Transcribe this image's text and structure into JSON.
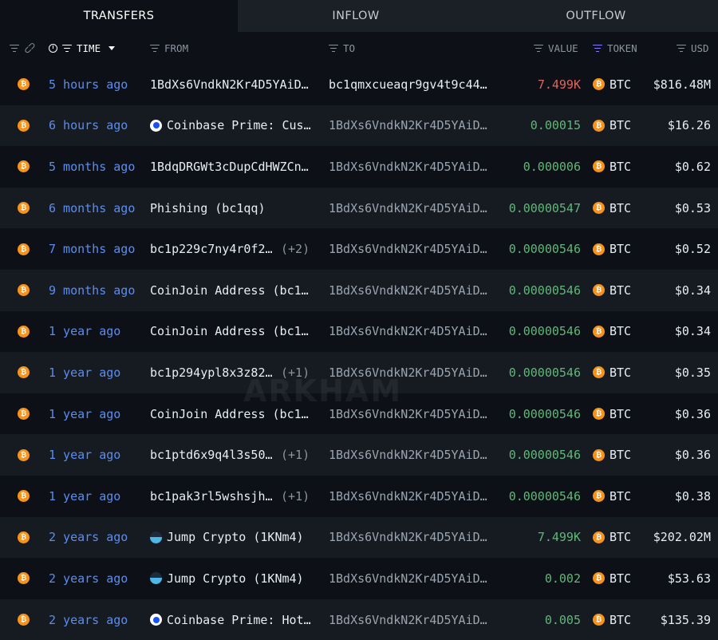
{
  "tabs": [
    {
      "label": "TRANSFERS",
      "active": true
    },
    {
      "label": "INFLOW",
      "active": false
    },
    {
      "label": "OUTFLOW",
      "active": false
    }
  ],
  "columns": {
    "time": "TIME",
    "from": "FROM",
    "to": "TO",
    "value": "VALUE",
    "token": "TOKEN",
    "usd": "USD"
  },
  "watermark": "ARKHAM",
  "colors": {
    "inflow": "#5fb877",
    "outflow": "#e0655d",
    "time_link": "#5b8def",
    "btc": "#f7931a"
  },
  "rows": [
    {
      "time": "5 hours ago",
      "from": "1BdXs6VndkN2Kr4D5YAiD…",
      "from_logo": "",
      "from_count": "",
      "to": "bc1qmxcueaqr9gv4t9c44…",
      "value": "7.499K",
      "direction": "out",
      "token": "BTC",
      "usd": "$816.48M"
    },
    {
      "time": "6 hours ago",
      "from": "Coinbase Prime: Cus…",
      "from_logo": "coinbase",
      "from_count": "",
      "to": "1BdXs6VndkN2Kr4D5YAiD…",
      "value": "0.00015",
      "direction": "in",
      "token": "BTC",
      "usd": "$16.26"
    },
    {
      "time": "5 months ago",
      "from": "1BdqDRGWt3cDupCdHWZCn…",
      "from_logo": "",
      "from_count": "",
      "to": "1BdXs6VndkN2Kr4D5YAiD…",
      "value": "0.000006",
      "direction": "in",
      "token": "BTC",
      "usd": "$0.62"
    },
    {
      "time": "6 months ago",
      "from": "Phishing (bc1qq)",
      "from_logo": "",
      "from_count": "",
      "to": "1BdXs6VndkN2Kr4D5YAiD…",
      "value": "0.00000547",
      "direction": "in",
      "token": "BTC",
      "usd": "$0.53"
    },
    {
      "time": "7 months ago",
      "from": "bc1p229c7ny4r0f2m…",
      "from_logo": "",
      "from_count": "(+2)",
      "to": "1BdXs6VndkN2Kr4D5YAiD…",
      "value": "0.00000546",
      "direction": "in",
      "token": "BTC",
      "usd": "$0.52"
    },
    {
      "time": "9 months ago",
      "from": "CoinJoin Address (bc1…",
      "from_logo": "",
      "from_count": "",
      "to": "1BdXs6VndkN2Kr4D5YAiD…",
      "value": "0.00000546",
      "direction": "in",
      "token": "BTC",
      "usd": "$0.34"
    },
    {
      "time": "1 year ago",
      "from": "CoinJoin Address (bc1…",
      "from_logo": "",
      "from_count": "",
      "to": "1BdXs6VndkN2Kr4D5YAiD…",
      "value": "0.00000546",
      "direction": "in",
      "token": "BTC",
      "usd": "$0.34"
    },
    {
      "time": "1 year ago",
      "from": "bc1p294ypl8x3z824…",
      "from_logo": "",
      "from_count": "(+1)",
      "to": "1BdXs6VndkN2Kr4D5YAiD…",
      "value": "0.00000546",
      "direction": "in",
      "token": "BTC",
      "usd": "$0.35"
    },
    {
      "time": "1 year ago",
      "from": "CoinJoin Address (bc1…",
      "from_logo": "",
      "from_count": "",
      "to": "1BdXs6VndkN2Kr4D5YAiD…",
      "value": "0.00000546",
      "direction": "in",
      "token": "BTC",
      "usd": "$0.36"
    },
    {
      "time": "1 year ago",
      "from": "bc1ptd6x9q4l3s50h…",
      "from_logo": "",
      "from_count": "(+1)",
      "to": "1BdXs6VndkN2Kr4D5YAiD…",
      "value": "0.00000546",
      "direction": "in",
      "token": "BTC",
      "usd": "$0.36"
    },
    {
      "time": "1 year ago",
      "from": "bc1pak3rl5wshsjhz…",
      "from_logo": "",
      "from_count": "(+1)",
      "to": "1BdXs6VndkN2Kr4D5YAiD…",
      "value": "0.00000546",
      "direction": "in",
      "token": "BTC",
      "usd": "$0.38"
    },
    {
      "time": "2 years ago",
      "from": "Jump Crypto (1KNm4)",
      "from_logo": "jump",
      "from_count": "",
      "to": "1BdXs6VndkN2Kr4D5YAiD…",
      "value": "7.499K",
      "direction": "in",
      "token": "BTC",
      "usd": "$202.02M"
    },
    {
      "time": "2 years ago",
      "from": "Jump Crypto (1KNm4)",
      "from_logo": "jump",
      "from_count": "",
      "to": "1BdXs6VndkN2Kr4D5YAiD…",
      "value": "0.002",
      "direction": "in",
      "token": "BTC",
      "usd": "$53.63"
    },
    {
      "time": "2 years ago",
      "from": "Coinbase Prime: Hot…",
      "from_logo": "coinbase",
      "from_count": "",
      "to": "1BdXs6VndkN2Kr4D5YAiD…",
      "value": "0.005",
      "direction": "in",
      "token": "BTC",
      "usd": "$135.39"
    }
  ]
}
